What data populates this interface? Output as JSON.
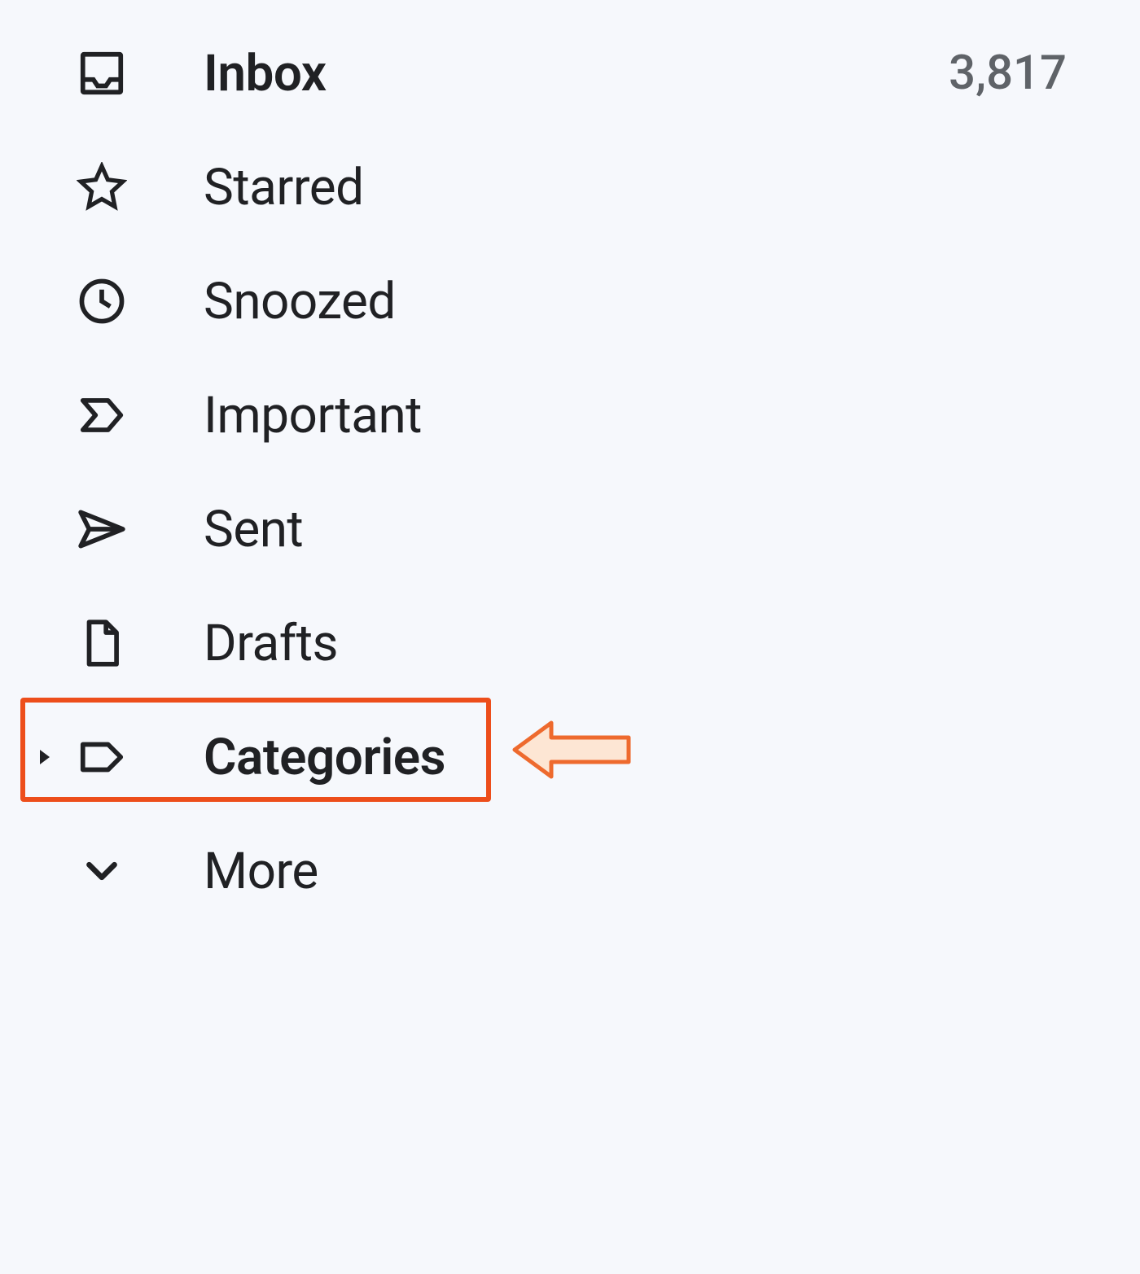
{
  "sidebar": {
    "items": [
      {
        "label": "Inbox",
        "count": "3,817",
        "bold": true
      },
      {
        "label": "Starred"
      },
      {
        "label": "Snoozed"
      },
      {
        "label": "Important"
      },
      {
        "label": "Sent"
      },
      {
        "label": "Drafts"
      },
      {
        "label": "Categories",
        "bold": true,
        "expandable": true
      },
      {
        "label": "More"
      }
    ]
  },
  "annotation": {
    "highlight_target": "categories"
  }
}
